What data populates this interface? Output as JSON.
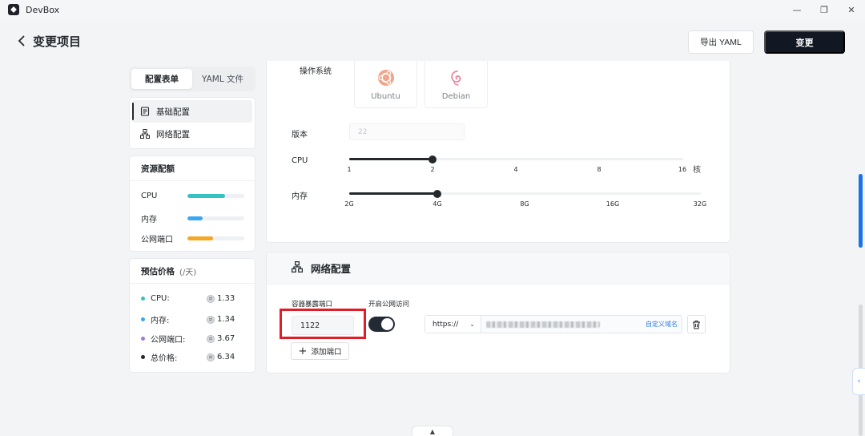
{
  "window": {
    "app_name": "DevBox",
    "minimize": "—",
    "restore": "❐",
    "close": "✕"
  },
  "header": {
    "title": "变更项目",
    "export_label": "导出 YAML",
    "submit_label": "变更"
  },
  "tabs": [
    {
      "label": "配置表单",
      "active": true
    },
    {
      "label": "YAML 文件",
      "active": false
    }
  ],
  "nav": [
    {
      "label": "基础配置",
      "active": true
    },
    {
      "label": "网络配置",
      "active": false
    }
  ],
  "resources": {
    "title": "资源配额",
    "items": [
      {
        "label": "CPU",
        "fill_percent": 66,
        "color": "#36c2c5"
      },
      {
        "label": "内存",
        "fill_percent": 27,
        "color": "#3ba7f0"
      },
      {
        "label": "公网端口",
        "fill_percent": 45,
        "color": "#f5a623"
      }
    ]
  },
  "pricing": {
    "title": "预估价格",
    "unit": "(/天)",
    "items": [
      {
        "label": "CPU:",
        "value": "1.33",
        "color": "#36c2c5"
      },
      {
        "label": "内存:",
        "value": "1.34",
        "color": "#3ba7f0"
      },
      {
        "label": "公网端口:",
        "value": "3.67",
        "color": "#9b7cd6"
      },
      {
        "label": "总价格:",
        "value": "6.34",
        "color": "#24282c"
      }
    ]
  },
  "basic": {
    "os_label": "操作系统",
    "os_options": [
      {
        "name": "Ubuntu",
        "icon": "ubuntu-icon"
      },
      {
        "name": "Debian",
        "icon": "debian-icon"
      }
    ],
    "version_label": "版本",
    "version_value": "22",
    "cpu": {
      "label": "CPU",
      "ticks": [
        "1",
        "2",
        "4",
        "8",
        "16"
      ],
      "selected": "2",
      "unit": "核"
    },
    "memory": {
      "label": "内存",
      "ticks": [
        "2G",
        "4G",
        "8G",
        "16G",
        "32G"
      ],
      "selected": "4G"
    }
  },
  "network": {
    "title": "网络配置",
    "port_label": "容器暴露端口",
    "port_value": "1122",
    "public_label": "开启公网访问",
    "public_enabled": true,
    "protocol": "https://",
    "custom_domain_label": "自定义域名",
    "add_port_label": "添加端口"
  }
}
